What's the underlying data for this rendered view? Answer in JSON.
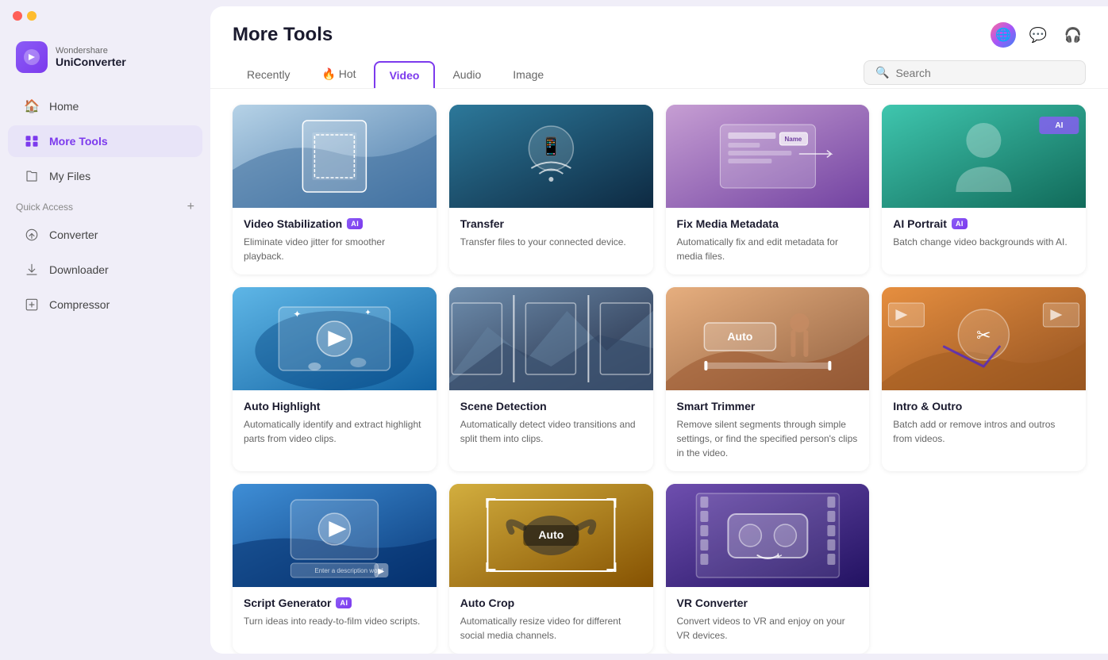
{
  "app": {
    "brand": "Wondershare",
    "name": "UniConverter"
  },
  "sidebar": {
    "nav": [
      {
        "id": "home",
        "label": "Home",
        "icon": "🏠",
        "active": false
      },
      {
        "id": "more-tools",
        "label": "More Tools",
        "icon": "🔧",
        "active": true
      },
      {
        "id": "my-files",
        "label": "My Files",
        "icon": "📁",
        "active": false
      }
    ],
    "quick_access_label": "Quick Access",
    "sub_nav": [
      {
        "id": "converter",
        "label": "Converter",
        "icon": "🔄"
      },
      {
        "id": "downloader",
        "label": "Downloader",
        "icon": "⬇"
      },
      {
        "id": "compressor",
        "label": "Compressor",
        "icon": "🗜"
      }
    ]
  },
  "page_title": "More Tools",
  "tabs": [
    {
      "id": "recently",
      "label": "Recently",
      "active": false
    },
    {
      "id": "hot",
      "label": "🔥 Hot",
      "active": false
    },
    {
      "id": "video",
      "label": "Video",
      "active": true
    },
    {
      "id": "audio",
      "label": "Audio",
      "active": false
    },
    {
      "id": "image",
      "label": "Image",
      "active": false
    }
  ],
  "search": {
    "placeholder": "Search"
  },
  "cards": [
    {
      "id": "video-stabilization",
      "title": "Video Stabilization",
      "ai": true,
      "description": "Eliminate video jitter for smoother playback.",
      "thumb_type": "stab"
    },
    {
      "id": "transfer",
      "title": "Transfer",
      "ai": false,
      "description": "Transfer files to your connected device.",
      "thumb_type": "transfer"
    },
    {
      "id": "fix-media-metadata",
      "title": "Fix Media Metadata",
      "ai": false,
      "description": "Automatically fix and edit metadata for media files.",
      "thumb_type": "fix-meta"
    },
    {
      "id": "ai-portrait",
      "title": "AI Portrait",
      "ai": true,
      "description": "Batch change video backgrounds with AI.",
      "thumb_type": "ai-portrait"
    },
    {
      "id": "auto-highlight",
      "title": "Auto Highlight",
      "ai": false,
      "description": "Automatically identify and extract highlight parts from video clips.",
      "thumb_type": "auto-highlight"
    },
    {
      "id": "scene-detection",
      "title": "Scene Detection",
      "ai": false,
      "description": "Automatically detect video transitions and split them into clips.",
      "thumb_type": "scene"
    },
    {
      "id": "smart-trimmer",
      "title": "Smart Trimmer",
      "ai": false,
      "description": "Remove silent segments through simple settings, or find the specified person's clips in the video.",
      "thumb_type": "smart-trimmer"
    },
    {
      "id": "intro-outro",
      "title": "Intro & Outro",
      "ai": false,
      "description": "Batch add or remove intros and outros from videos.",
      "thumb_type": "intro-outro"
    },
    {
      "id": "script-generator",
      "title": "Script Generator",
      "ai": true,
      "description": "Turn ideas into ready-to-film video scripts.",
      "thumb_type": "script"
    },
    {
      "id": "auto-crop",
      "title": "Auto Crop",
      "ai": false,
      "description": "Automatically resize video for different social media channels.",
      "thumb_type": "auto-crop"
    },
    {
      "id": "vr-converter",
      "title": "VR Converter",
      "ai": false,
      "description": "Convert videos to VR and enjoy on your VR devices.",
      "thumb_type": "vr"
    }
  ]
}
